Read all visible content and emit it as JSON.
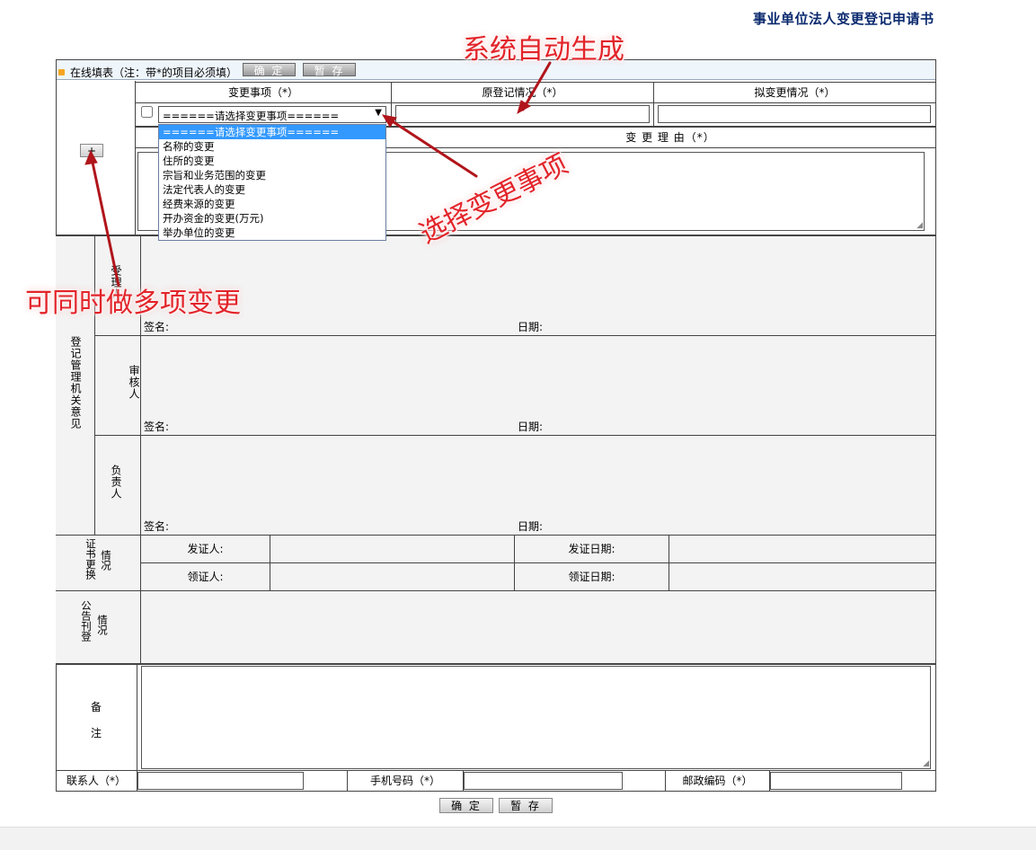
{
  "doc_title": "事业单位法人变更登记申请书",
  "toolbar": {
    "label": "在线填表（注：带*的项目必须填）",
    "confirm_label": "确 定",
    "save_label": "暂 存"
  },
  "change_table": {
    "headers": [
      "变更事项（*）",
      "原登记情况（*）",
      "拟变更情况（*）"
    ],
    "add_button": "+",
    "reason_header": "变 更 理 由（*）",
    "select_value": "======请选择变更事项======",
    "options": [
      "======请选择变更事项======",
      "名称的变更",
      "住所的变更",
      "宗旨和业务范围的变更",
      "法定代表人的变更",
      "经费来源的变更",
      "开办资金的变更(万元)",
      "举办单位的变更"
    ],
    "selected_index": 0
  },
  "opinion": {
    "section_label": "登记管理机关意见",
    "rows": [
      {
        "role": "受理人",
        "sign": "签名:",
        "date": "日期:"
      },
      {
        "role": "审核人",
        "sign": "签名:",
        "date": "日期:"
      },
      {
        "role": "负责人",
        "sign": "签名:",
        "date": "日期:"
      }
    ]
  },
  "certificate": {
    "label_left": "证书更换",
    "label_right": "情况",
    "issuer": "发证人:",
    "issue_date": "发证日期:",
    "receiver": "领证人:",
    "receive_date": "领证日期:"
  },
  "announcement": {
    "label_left": "公告刊登",
    "label_right": "情况"
  },
  "remarks": {
    "label_1": "备",
    "label_2": "注"
  },
  "contact_row": {
    "contact_label": "联系人（*）",
    "phone_label": "手机号码（*）",
    "postcode_label": "邮政编码（*）"
  },
  "bottom_buttons": {
    "confirm_label": "确 定",
    "save_label": "暂 存"
  },
  "annotations": {
    "auto_generate": "系统自动生成",
    "select_item": "选择变更事项",
    "multi_change": "可同时做多项变更",
    "color": "#e2242a"
  }
}
